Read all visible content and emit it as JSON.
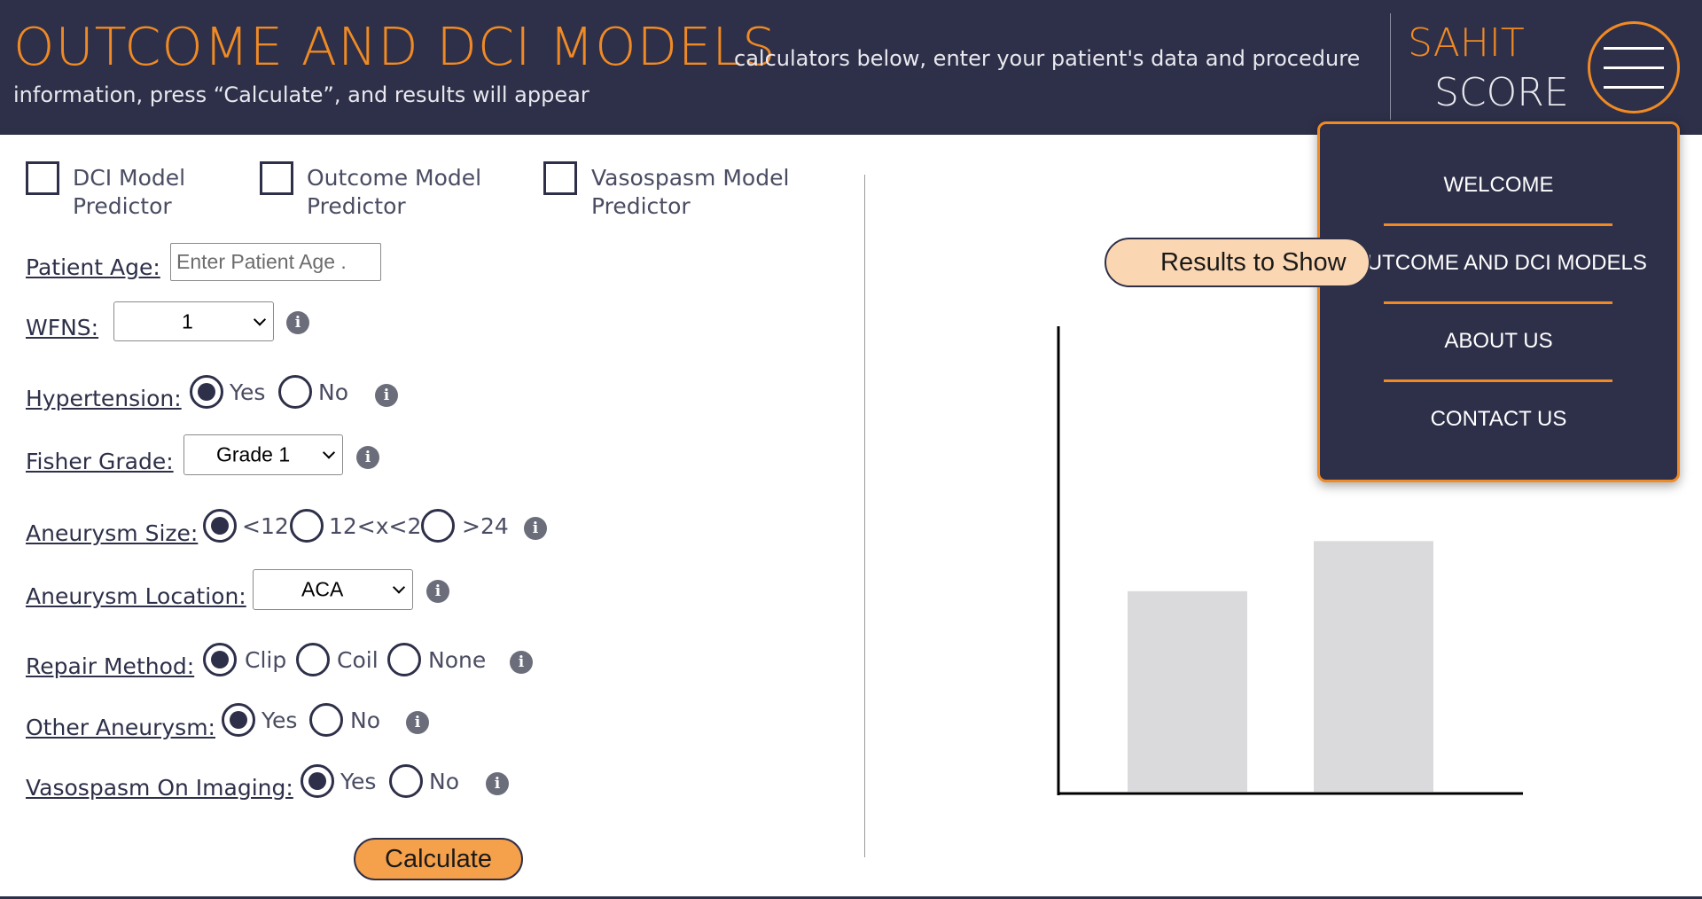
{
  "header": {
    "title": "OUTCOME AND DCI MODELS",
    "subtitle_line1": "calculators below, enter your patient's data and procedure",
    "subtitle_line2": "information, press “Calculate”, and results will appear",
    "logo_top": "SAHIT",
    "logo_bottom": "SCORE",
    "menu_icon": "hamburger-menu-icon"
  },
  "dropdown": {
    "items": [
      {
        "label": "WELCOME"
      },
      {
        "label": "OUTCOME AND DCI MODELS"
      },
      {
        "label": "ABOUT US"
      },
      {
        "label": "CONTACT US"
      }
    ]
  },
  "models": [
    {
      "label_line1": "DCI Model",
      "label_line2": "Predictor",
      "checked": false
    },
    {
      "label_line1": "Outcome Model",
      "label_line2": "Predictor",
      "checked": false
    },
    {
      "label_line1": "Vasospasm Model",
      "label_line2": "Predictor",
      "checked": false
    }
  ],
  "form": {
    "patient_age": {
      "label": "Patient Age:",
      "placeholder": "Enter Patient Age .",
      "value": ""
    },
    "wfns": {
      "label": "WFNS:",
      "value": "1"
    },
    "hypertension": {
      "label": "Hypertension:",
      "options": [
        "Yes",
        "No"
      ],
      "selected": "Yes"
    },
    "fisher_grade": {
      "label": "Fisher Grade:",
      "value": "Grade 1"
    },
    "aneurysm_size": {
      "label": "Aneurysm Size:",
      "options": [
        "<12",
        "12<x<24",
        ">24"
      ],
      "selected": "<12"
    },
    "aneurysm_location": {
      "label": "Aneurysm Location:",
      "value": "ACA"
    },
    "repair_method": {
      "label": "Repair Method:",
      "options": [
        "Clip",
        "Coil",
        "None"
      ],
      "selected": "Clip"
    },
    "other_aneurysm": {
      "label": "Other Aneurysm:",
      "options": [
        "Yes",
        "No"
      ],
      "selected": "Yes"
    },
    "vasospasm_on_imaging": {
      "label": "Vasospasm On Imaging:",
      "options": [
        "Yes",
        "No"
      ],
      "selected": "Yes"
    },
    "calculate_label": "Calculate",
    "info_icon": "info-icon",
    "info_glyph": "i"
  },
  "results": {
    "button_label": "Results to Show"
  },
  "colors": {
    "navy": "#2e3049",
    "orange": "#f08a24",
    "calc_button": "#f5a04a",
    "results_button": "#fbd6b2",
    "placeholder_bar": "#dadadd"
  },
  "chart_data": {
    "type": "bar",
    "categories": [
      "",
      ""
    ],
    "values": [
      56,
      70
    ],
    "ylim": [
      0,
      130
    ],
    "title": "",
    "xlabel": "",
    "ylabel": "",
    "grid": false
  }
}
